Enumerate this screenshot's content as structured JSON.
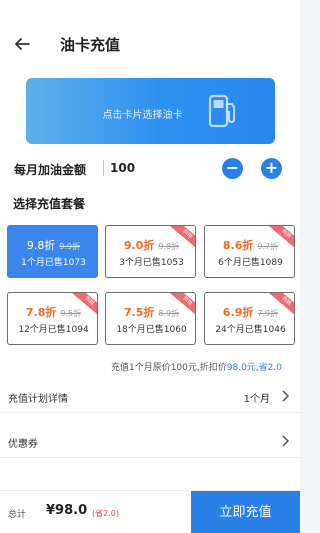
{
  "header": {
    "title": "油卡充值",
    "back_icon": "arrow-left-icon"
  },
  "card": {
    "hint": "点击卡片选择油卡",
    "icon": "fuel-pump-icon"
  },
  "amount": {
    "label": "每月加油金额",
    "value": "100",
    "minus": "−",
    "plus": "+"
  },
  "packages": {
    "title": "选择充值套餐",
    "items": [
      {
        "discount": "9.8折",
        "original": "9.9折",
        "sold": "1个月已售1073",
        "badge": "",
        "selected": true
      },
      {
        "discount": "9.0折",
        "original": "9.8折",
        "sold": "3个月已售1053",
        "badge": "热销",
        "selected": false
      },
      {
        "discount": "8.6折",
        "original": "9.7折",
        "sold": "6个月已售1089",
        "badge": "热销",
        "selected": false
      },
      {
        "discount": "7.8折",
        "original": "9.5折",
        "sold": "12个月已售1094",
        "badge": "热销",
        "selected": false
      },
      {
        "discount": "7.5折",
        "original": "8.9折",
        "sold": "18个月已售1060",
        "badge": "热销",
        "selected": false
      },
      {
        "discount": "6.9折",
        "original": "7.9折",
        "sold": "24个月已售1046",
        "badge": "热销",
        "selected": false
      }
    ]
  },
  "summary": {
    "prefix": "充值1个月原价100元,折扣价",
    "price": "98.0元",
    "sep": ",",
    "save": "省2.0"
  },
  "plan": {
    "label": "充值计划详情",
    "value": "1个月"
  },
  "coupon": {
    "label": "优惠券"
  },
  "footer": {
    "total_label": "总计",
    "total": "¥98.0",
    "save": "(省2.0)",
    "pay_label": "立即充值"
  },
  "colors": {
    "accent": "#2b80e8",
    "discount": "#f26b21",
    "badge": "#f06a72"
  }
}
